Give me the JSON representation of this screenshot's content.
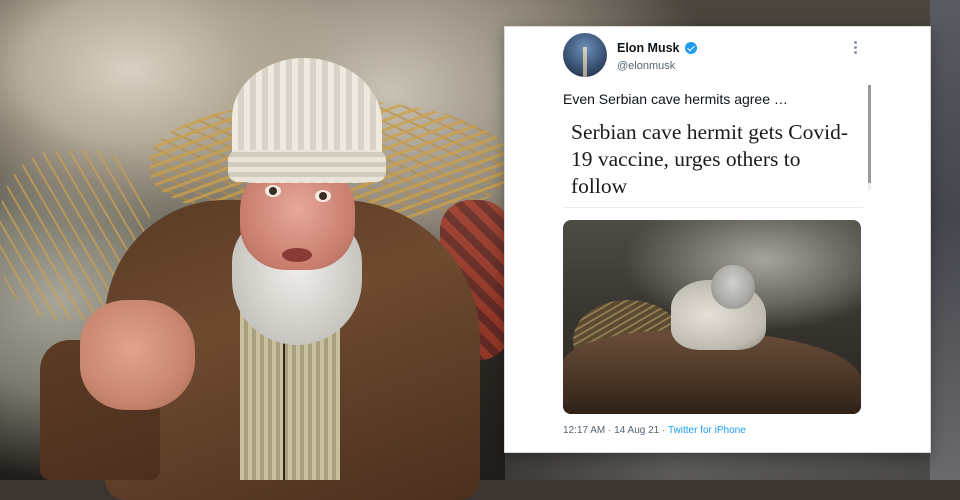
{
  "tweet": {
    "author_name": "Elon Musk",
    "author_handle": "@elonmusk",
    "verified_icon": "verified-badge",
    "more_icon": "more-options",
    "text": "Even Serbian cave hermits agree …",
    "headline": "Serbian cave hermit gets Covid-19 vaccine, urges others to follow",
    "time": "12:17 AM",
    "date": "14 Aug 21",
    "source": "Twitter for iPhone",
    "separator": "·"
  },
  "colors": {
    "link_blue": "#1d9bf0",
    "text_primary": "#0f1419",
    "text_secondary": "#536471"
  }
}
